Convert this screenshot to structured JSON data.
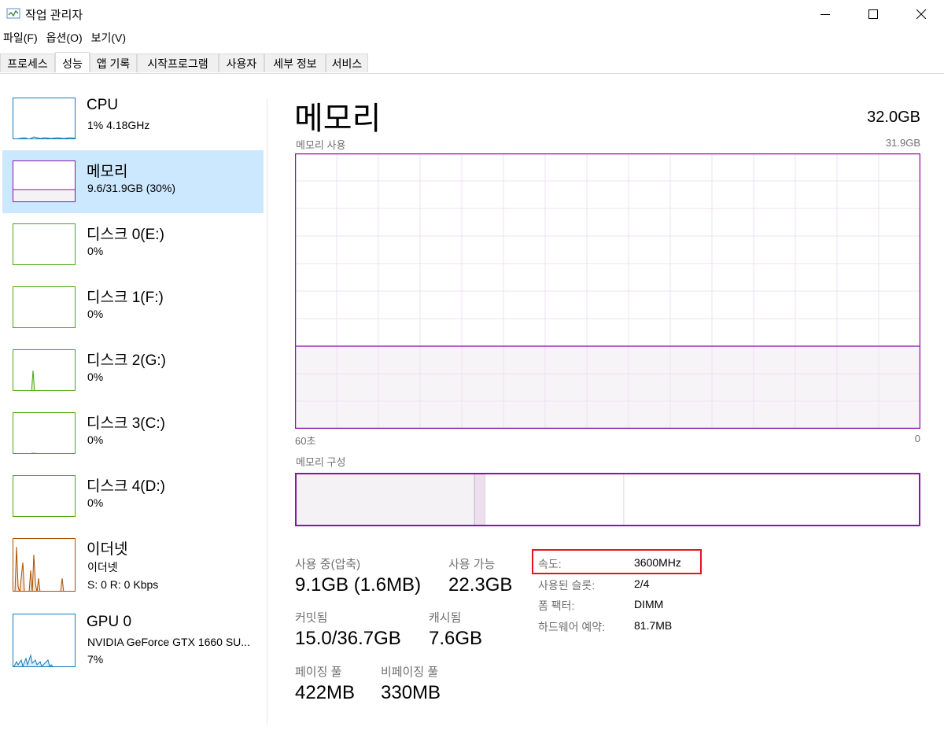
{
  "window": {
    "title": "작업 관리자",
    "controls": [
      "minimize",
      "maximize",
      "close"
    ]
  },
  "menu": [
    "파일(F)",
    "옵션(O)",
    "보기(V)"
  ],
  "tabs": [
    "프로세스",
    "성능",
    "앱 기록",
    "시작프로그램",
    "사용자",
    "세부 정보",
    "서비스"
  ],
  "active_tab": "성능",
  "sidebar": [
    {
      "title": "CPU",
      "lines": [
        "1% 4.18GHz"
      ],
      "color": "#117dbb"
    },
    {
      "title": "메모리",
      "lines": [
        "9.6/31.9GB (30%)"
      ],
      "color": "#8b12ae",
      "selected": true
    },
    {
      "title": "디스크 0(E:)",
      "lines": [
        "0%"
      ],
      "color": "#4da60c"
    },
    {
      "title": "디스크 1(F:)",
      "lines": [
        "0%"
      ],
      "color": "#4da60c"
    },
    {
      "title": "디스크 2(G:)",
      "lines": [
        "0%"
      ],
      "color": "#4da60c"
    },
    {
      "title": "디스크 3(C:)",
      "lines": [
        "0%"
      ],
      "color": "#4da60c"
    },
    {
      "title": "디스크 4(D:)",
      "lines": [
        "0%"
      ],
      "color": "#4da60c"
    },
    {
      "title": "이더넷",
      "lines": [
        "이더넷",
        "S: 0  R: 0 Kbps"
      ],
      "color": "#a74f01"
    },
    {
      "title": "GPU 0",
      "lines": [
        "NVIDIA GeForce GTX 1660 SU...",
        "7%"
      ],
      "color": "#117dbb"
    }
  ],
  "main": {
    "title": "메모리",
    "total": "32.0GB",
    "usage_label": "메모리 사용",
    "usage_max": "31.9GB",
    "usage_fraction": 0.3,
    "time_left": "60초",
    "time_right": "0",
    "composition_label": "메모리 구성",
    "composition": {
      "in_use": 0.287,
      "modified": 0.017,
      "standby": 0.222
    },
    "stats": [
      {
        "label": "사용 중(압축)",
        "value": "9.1GB (1.6MB)"
      },
      {
        "label": "사용 가능",
        "value": "22.3GB"
      },
      {
        "label": "커밋됨",
        "value": "15.0/36.7GB"
      },
      {
        "label": "캐시됨",
        "value": "7.6GB"
      },
      {
        "label": "페이징 풀",
        "value": "422MB"
      },
      {
        "label": "비페이징 풀",
        "value": "330MB"
      }
    ],
    "specs": [
      {
        "label": "속도:",
        "value": "3600MHz"
      },
      {
        "label": "사용된 슬롯:",
        "value": "2/4"
      },
      {
        "label": "폼 팩터:",
        "value": "DIMM"
      },
      {
        "label": "하드웨어 예약:",
        "value": "81.7MB"
      }
    ],
    "highlight_color": "#e81123"
  },
  "colors": {
    "memory": "#8b12ae",
    "memory_fill": "#f4f2f4",
    "grid": "#efe0f3"
  }
}
